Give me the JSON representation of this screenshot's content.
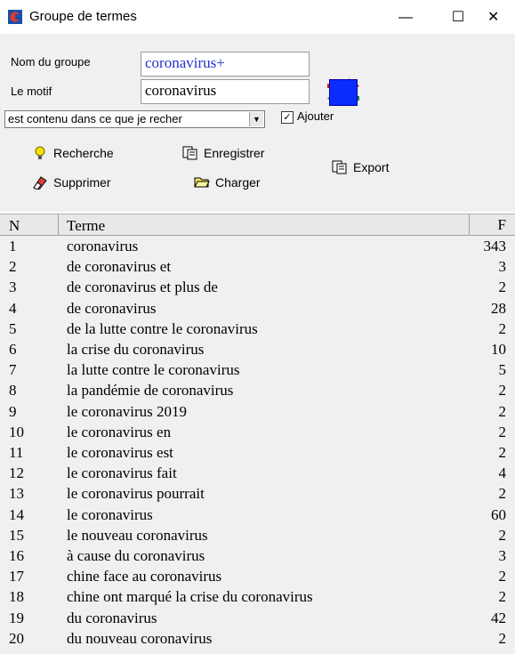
{
  "window": {
    "title": "Groupe de termes",
    "min_glyph": "—",
    "max_glyph": "☐",
    "close_glyph": "✕"
  },
  "form": {
    "group_label": "Nom du groupe",
    "group_value": "coronavirus+",
    "pattern_label": "Le motif",
    "pattern_value": "coronavirus",
    "match_mode": "est contenu dans ce que je recher",
    "add_label": "Ajouter",
    "add_checked": true,
    "swatch_color": "#0a2cff"
  },
  "toolbar": {
    "search_label": "Recherche",
    "save_label": "Enregistrer",
    "export_label": "Export",
    "delete_label": "Supprimer",
    "load_label": "Charger"
  },
  "table": {
    "columns": [
      "N",
      "Terme",
      "F"
    ],
    "rows": [
      {
        "n": "1",
        "terme": "coronavirus",
        "f": "343"
      },
      {
        "n": "2",
        "terme": "de coronavirus et",
        "f": "3"
      },
      {
        "n": "3",
        "terme": "de coronavirus et plus de",
        "f": "2"
      },
      {
        "n": "4",
        "terme": "de coronavirus",
        "f": "28"
      },
      {
        "n": "5",
        "terme": "de la lutte contre le coronavirus",
        "f": "2"
      },
      {
        "n": "6",
        "terme": "la crise du coronavirus",
        "f": "10"
      },
      {
        "n": "7",
        "terme": "la lutte contre le coronavirus",
        "f": "5"
      },
      {
        "n": "8",
        "terme": "la pandémie de coronavirus",
        "f": "2"
      },
      {
        "n": "9",
        "terme": "le coronavirus 2019",
        "f": "2"
      },
      {
        "n": "10",
        "terme": "le coronavirus en",
        "f": "2"
      },
      {
        "n": "11",
        "terme": "le coronavirus est",
        "f": "2"
      },
      {
        "n": "12",
        "terme": "le coronavirus fait",
        "f": "4"
      },
      {
        "n": "13",
        "terme": "le coronavirus pourrait",
        "f": "2"
      },
      {
        "n": "14",
        "terme": "le coronavirus",
        "f": "60"
      },
      {
        "n": "15",
        "terme": "le nouveau coronavirus",
        "f": "2"
      },
      {
        "n": "16",
        "terme": "à cause du coronavirus",
        "f": "3"
      },
      {
        "n": "17",
        "terme": "chine face au coronavirus",
        "f": "2"
      },
      {
        "n": "18",
        "terme": "chine ont marqué la crise du coronavirus",
        "f": "2"
      },
      {
        "n": "19",
        "terme": "du coronavirus",
        "f": "42"
      },
      {
        "n": "20",
        "terme": "du nouveau coronavirus",
        "f": "2"
      }
    ]
  }
}
